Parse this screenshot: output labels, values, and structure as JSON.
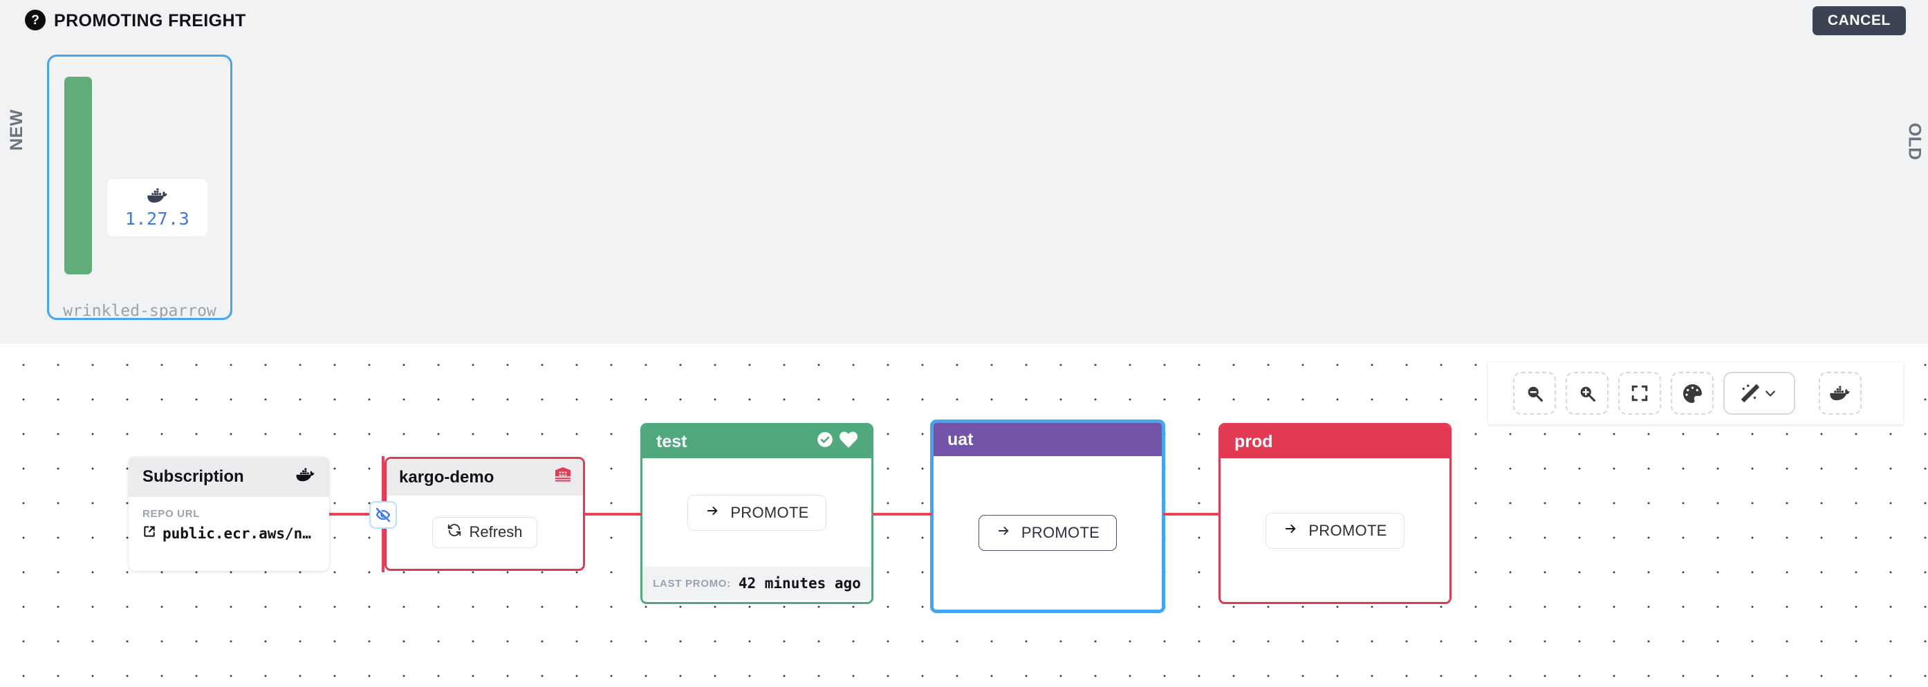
{
  "header": {
    "title": "PROMOTING FREIGHT",
    "help_icon": "question-mark-circle-icon",
    "cancel_label": "CANCEL"
  },
  "promotion_strip": {
    "new_label": "NEW",
    "old_label": "OLD",
    "freight": {
      "version": "1.27.3",
      "name": "wrinkled-sparrow",
      "image_icon": "docker-whale-icon",
      "bar_color": "#62ac79",
      "selected_border_color": "#44a6f0"
    }
  },
  "toolbar": {
    "buttons": [
      {
        "name": "zoom-out-icon",
        "label": "Zoom out"
      },
      {
        "name": "zoom-in-icon",
        "label": "Zoom in"
      },
      {
        "name": "fit-view-icon",
        "label": "Fit view"
      },
      {
        "name": "palette-icon",
        "label": "Color theme"
      },
      {
        "name": "magic-wand-icon",
        "label": "Auto layout"
      },
      {
        "name": "docker-whale-icon",
        "label": "Images"
      }
    ]
  },
  "pipeline": {
    "subscription": {
      "title": "Subscription",
      "icon": "docker-whale-icon",
      "field_label": "REPO URL",
      "field_value": "public.ecr.aws/n…",
      "link_icon": "external-link-icon"
    },
    "warehouse": {
      "title": "kargo-demo",
      "icon": "warehouse-icon",
      "refresh_label": "Refresh",
      "refresh_icon": "refresh-icon",
      "badge_icon": "eye-off-icon",
      "border_color": "#e23a53"
    },
    "stages": [
      {
        "name": "test",
        "header_color": "#4fa97d",
        "promote_label": "PROMOTE",
        "promote_icon": "arrow-right-icon",
        "icons": [
          "check-circle-icon",
          "heart-icon"
        ],
        "footer_label": "LAST PROMO:",
        "footer_value": "42 minutes ago",
        "selected": false
      },
      {
        "name": "uat",
        "header_color": "#7253a8",
        "promote_label": "PROMOTE",
        "promote_icon": "arrow-right-icon",
        "icons": [],
        "selected": true,
        "selected_border_color": "#44a6f0"
      },
      {
        "name": "prod",
        "header_color": "#e23a53",
        "promote_label": "PROMOTE",
        "promote_icon": "arrow-right-icon",
        "icons": [],
        "selected": false
      }
    ],
    "edge_color": "#e44258"
  }
}
